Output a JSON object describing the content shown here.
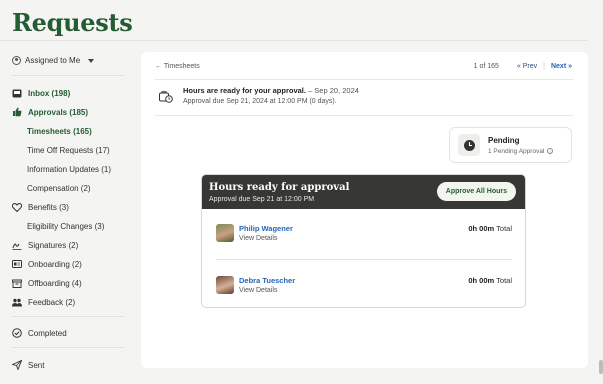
{
  "page": {
    "title": "Requests"
  },
  "sidebar": {
    "filter_label": "Assigned to Me",
    "items": [
      {
        "label": "Inbox (198)",
        "icon": "inbox-icon"
      },
      {
        "label": "Approvals (185)",
        "icon": "thumbs-up-icon"
      },
      {
        "label": "Timesheets (165)"
      },
      {
        "label": "Time Off Requests (17)"
      },
      {
        "label": "Information Updates (1)"
      },
      {
        "label": "Compensation (2)"
      },
      {
        "label": "Benefits (3)",
        "icon": "heart-icon"
      },
      {
        "label": "Eligibility Changes (3)"
      },
      {
        "label": "Signatures (2)",
        "icon": "signature-icon"
      },
      {
        "label": "Onboarding (2)",
        "icon": "id-card-icon"
      },
      {
        "label": "Offboarding (4)",
        "icon": "box-icon"
      },
      {
        "label": "Feedback (2)",
        "icon": "people-icon"
      },
      {
        "label": "Completed",
        "icon": "check-circle-icon"
      },
      {
        "label": "Sent",
        "icon": "send-icon"
      }
    ]
  },
  "main": {
    "back_link": "← Timesheets",
    "pager": {
      "count": "1 of 165",
      "prev": "« Prev",
      "next": "Next »"
    },
    "summary": {
      "title": "Hours are ready for your approval.",
      "date": " – Sep 20, 2024",
      "due": "Approval due Sep 21, 2024 at 12:00 PM (0 days)."
    },
    "status": {
      "title": "Pending",
      "subtitle": "1 Pending Approval"
    },
    "panel": {
      "title": "Hours ready for approval",
      "subtitle": "Approval due Sep 21 at 12:00 PM",
      "approve_all": "Approve All Hours",
      "employees": [
        {
          "name": "Philip Wagener",
          "view": "View Details",
          "hours": "0h 00m",
          "total_label": "Total"
        },
        {
          "name": "Debra Tuescher",
          "view": "View Details",
          "hours": "0h 00m",
          "total_label": "Total"
        }
      ]
    }
  },
  "colors": {
    "brand_green": "#245c34",
    "link_blue": "#2367b7",
    "panel_head": "#373735"
  }
}
